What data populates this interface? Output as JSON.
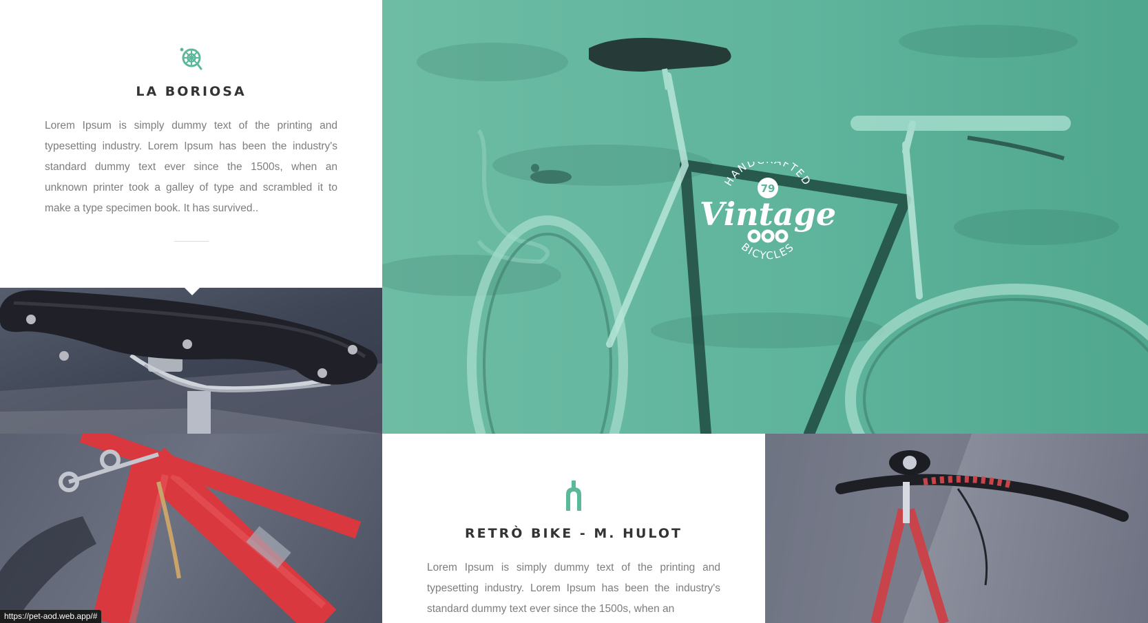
{
  "features": [
    {
      "icon": "sprocket-icon",
      "title": "LA BORIOSA",
      "text": "Lorem Ipsum is simply dummy text of the printing and typesetting industry. Lorem Ipsum has been the industry's standard dummy text ever since the 1500s, when an unknown printer took a galley of type and scrambled it to make a type specimen book. It has survived.."
    },
    {
      "icon": "bike-fork-icon",
      "title": "RETRÒ BIKE - M. HULOT",
      "text": "Lorem Ipsum is simply dummy text of the printing and typesetting industry. Lorem Ipsum has been the industry's standard dummy text ever since the 1500s, when an"
    }
  ],
  "hero": {
    "badge_top": "HANDCRAFTED",
    "badge_number": "79",
    "badge_main": "Vintage",
    "badge_bottom": "BICYCLES",
    "overlay_color": "#5fb49c"
  },
  "colors": {
    "accent": "#5bb89a",
    "heading": "#333333",
    "body_text": "#7d7d7d"
  },
  "photos": [
    {
      "name": "saddle-photo",
      "subject": "leather saddle"
    },
    {
      "name": "red-frame-photo",
      "subject": "red bicycle frame"
    },
    {
      "name": "handlebar-photo",
      "subject": "red bike leaning on wall"
    }
  ],
  "status_url": "https://pet-aod.web.app/#"
}
